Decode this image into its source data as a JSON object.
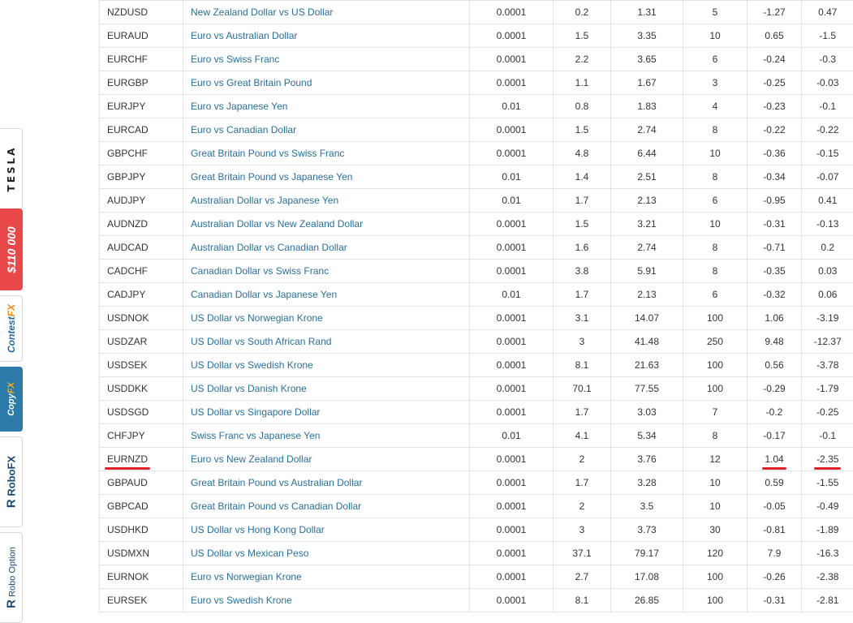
{
  "sidebar": {
    "tesla_label": "TESLA",
    "prize_label": "$110 000",
    "contest": {
      "main": "Contest",
      "fx": "FX"
    },
    "copy": {
      "main": "Copy",
      "fx": "FX"
    },
    "robofx": {
      "r": "R",
      "text": "RoboFX"
    },
    "robooption": {
      "r": "R",
      "text": "Robo Option"
    },
    "colors": {
      "prize": "#e8484a",
      "copy": "#2c7aa8",
      "accent": "#f08a1c"
    }
  },
  "table": {
    "rows": [
      {
        "symbol": "NZDUSD",
        "description": "New Zealand Dollar vs US Dollar",
        "point": "0.0001",
        "c1": "0.2",
        "c2": "1.31",
        "c3": "5",
        "swap_long": "-1.27",
        "swap_short": "0.47"
      },
      {
        "symbol": "EURAUD",
        "description": "Euro vs Australian Dollar",
        "point": "0.0001",
        "c1": "1.5",
        "c2": "3.35",
        "c3": "10",
        "swap_long": "0.65",
        "swap_short": "-1.5"
      },
      {
        "symbol": "EURCHF",
        "description": "Euro vs Swiss Franc",
        "point": "0.0001",
        "c1": "2.2",
        "c2": "3.65",
        "c3": "6",
        "swap_long": "-0.24",
        "swap_short": "-0.3"
      },
      {
        "symbol": "EURGBP",
        "description": "Euro vs Great Britain Pound",
        "point": "0.0001",
        "c1": "1.1",
        "c2": "1.67",
        "c3": "3",
        "swap_long": "-0.25",
        "swap_short": "-0.03"
      },
      {
        "symbol": "EURJPY",
        "description": "Euro vs Japanese Yen",
        "point": "0.01",
        "c1": "0.8",
        "c2": "1.83",
        "c3": "4",
        "swap_long": "-0.23",
        "swap_short": "-0.1"
      },
      {
        "symbol": "EURCAD",
        "description": "Euro vs Canadian Dollar",
        "point": "0.0001",
        "c1": "1.5",
        "c2": "2.74",
        "c3": "8",
        "swap_long": "-0.22",
        "swap_short": "-0.22"
      },
      {
        "symbol": "GBPCHF",
        "description": "Great Britain Pound vs Swiss Franc",
        "point": "0.0001",
        "c1": "4.8",
        "c2": "6.44",
        "c3": "10",
        "swap_long": "-0.36",
        "swap_short": "-0.15"
      },
      {
        "symbol": "GBPJPY",
        "description": "Great Britain Pound vs Japanese Yen",
        "point": "0.01",
        "c1": "1.4",
        "c2": "2.51",
        "c3": "8",
        "swap_long": "-0.34",
        "swap_short": "-0.07"
      },
      {
        "symbol": "AUDJPY",
        "description": "Australian Dollar vs Japanese Yen",
        "point": "0.01",
        "c1": "1.7",
        "c2": "2.13",
        "c3": "6",
        "swap_long": "-0.95",
        "swap_short": "0.41"
      },
      {
        "symbol": "AUDNZD",
        "description": "Australian Dollar vs New Zealand Dollar",
        "point": "0.0001",
        "c1": "1.5",
        "c2": "3.21",
        "c3": "10",
        "swap_long": "-0.31",
        "swap_short": "-0.13"
      },
      {
        "symbol": "AUDCAD",
        "description": "Australian Dollar vs Canadian Dollar",
        "point": "0.0001",
        "c1": "1.6",
        "c2": "2.74",
        "c3": "8",
        "swap_long": "-0.71",
        "swap_short": "0.2"
      },
      {
        "symbol": "CADCHF",
        "description": "Canadian Dollar vs Swiss Franc",
        "point": "0.0001",
        "c1": "3.8",
        "c2": "5.91",
        "c3": "8",
        "swap_long": "-0.35",
        "swap_short": "0.03"
      },
      {
        "symbol": "CADJPY",
        "description": "Canadian Dollar vs Japanese Yen",
        "point": "0.01",
        "c1": "1.7",
        "c2": "2.13",
        "c3": "6",
        "swap_long": "-0.32",
        "swap_short": "0.06"
      },
      {
        "symbol": "USDNOK",
        "description": "US Dollar vs Norwegian Krone",
        "point": "0.0001",
        "c1": "3.1",
        "c2": "14.07",
        "c3": "100",
        "swap_long": "1.06",
        "swap_short": "-3.19"
      },
      {
        "symbol": "USDZAR",
        "description": "US Dollar vs South African Rand",
        "point": "0.0001",
        "c1": "3",
        "c2": "41.48",
        "c3": "250",
        "swap_long": "9.48",
        "swap_short": "-12.37"
      },
      {
        "symbol": "USDSEK",
        "description": "US Dollar vs Swedish Krone",
        "point": "0.0001",
        "c1": "8.1",
        "c2": "21.63",
        "c3": "100",
        "swap_long": "0.56",
        "swap_short": "-3.78"
      },
      {
        "symbol": "USDDKK",
        "description": "US Dollar vs Danish Krone",
        "point": "0.0001",
        "c1": "70.1",
        "c2": "77.55",
        "c3": "100",
        "swap_long": "-0.29",
        "swap_short": "-1.79"
      },
      {
        "symbol": "USDSGD",
        "description": "US Dollar vs Singapore Dollar",
        "point": "0.0001",
        "c1": "1.7",
        "c2": "3.03",
        "c3": "7",
        "swap_long": "-0.2",
        "swap_short": "-0.25"
      },
      {
        "symbol": "CHFJPY",
        "description": "Swiss Franc vs Japanese Yen",
        "point": "0.01",
        "c1": "4.1",
        "c2": "5.34",
        "c3": "8",
        "swap_long": "-0.17",
        "swap_short": "-0.1"
      },
      {
        "symbol": "EURNZD",
        "description": "Euro vs New Zealand Dollar",
        "point": "0.0001",
        "c1": "2",
        "c2": "3.76",
        "c3": "12",
        "swap_long": "1.04",
        "swap_short": "-2.35",
        "highlight": true
      },
      {
        "symbol": "GBPAUD",
        "description": "Great Britain Pound vs Australian Dollar",
        "point": "0.0001",
        "c1": "1.7",
        "c2": "3.28",
        "c3": "10",
        "swap_long": "0.59",
        "swap_short": "-1.55"
      },
      {
        "symbol": "GBPCAD",
        "description": "Great Britain Pound vs Canadian Dollar",
        "point": "0.0001",
        "c1": "2",
        "c2": "3.5",
        "c3": "10",
        "swap_long": "-0.05",
        "swap_short": "-0.49"
      },
      {
        "symbol": "USDHKD",
        "description": "US Dollar vs Hong Kong Dollar",
        "point": "0.0001",
        "c1": "3",
        "c2": "3.73",
        "c3": "30",
        "swap_long": "-0.81",
        "swap_short": "-1.89"
      },
      {
        "symbol": "USDMXN",
        "description": "US Dollar vs Mexican Peso",
        "point": "0.0001",
        "c1": "37.1",
        "c2": "79.17",
        "c3": "120",
        "swap_long": "7.9",
        "swap_short": "-16.3"
      },
      {
        "symbol": "EURNOK",
        "description": "Euro vs Norwegian Krone",
        "point": "0.0001",
        "c1": "2.7",
        "c2": "17.08",
        "c3": "100",
        "swap_long": "-0.26",
        "swap_short": "-2.38"
      },
      {
        "symbol": "EURSEK",
        "description": "Euro vs Swedish Krone",
        "point": "0.0001",
        "c1": "8.1",
        "c2": "26.85",
        "c3": "100",
        "swap_long": "-0.31",
        "swap_short": "-2.81"
      }
    ]
  }
}
